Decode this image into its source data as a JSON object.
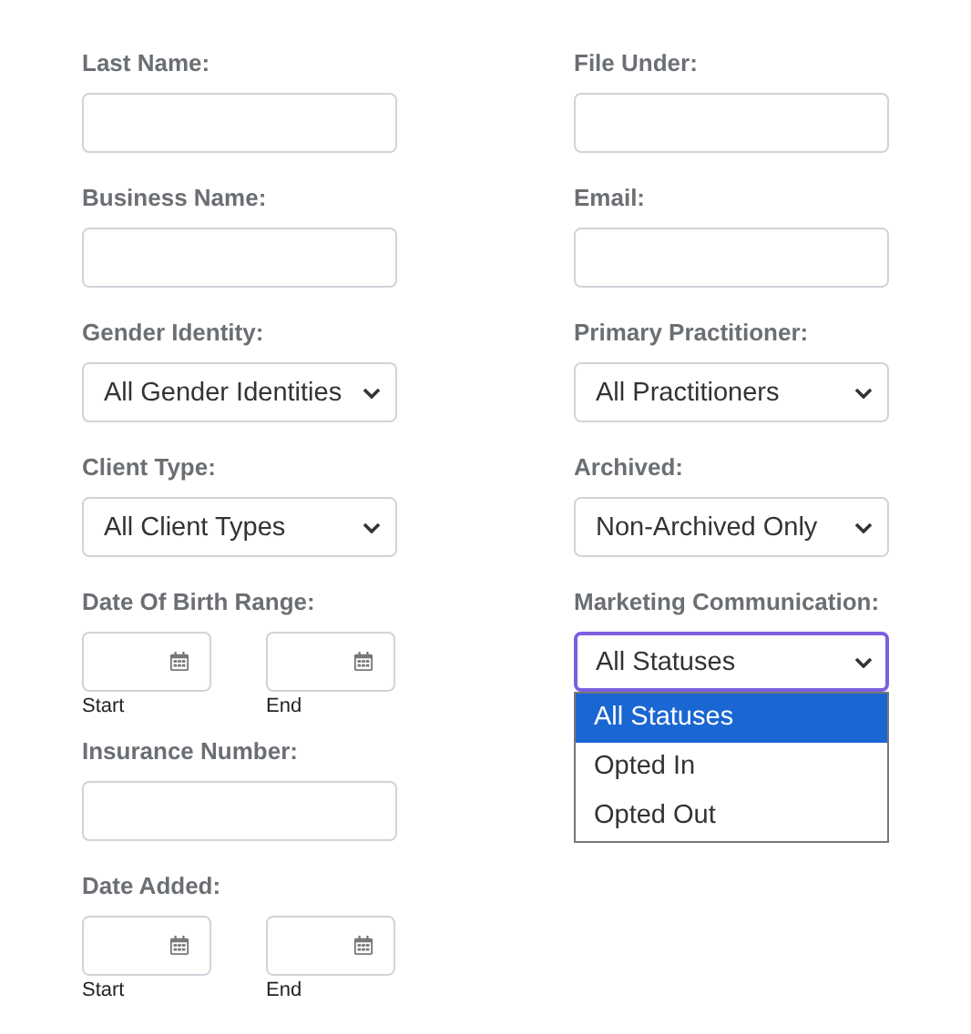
{
  "columns": [
    {
      "fields": [
        {
          "kind": "text",
          "label": "Last Name:"
        },
        {
          "kind": "text",
          "label": "Business Name:"
        },
        {
          "kind": "select",
          "label": "Gender Identity:",
          "value": "All Gender Identities",
          "focused": false,
          "open": false
        },
        {
          "kind": "select",
          "label": "Client Type:",
          "value": "All Client Types",
          "focused": false,
          "open": false
        },
        {
          "kind": "daterange",
          "label": "Date Of Birth Range:",
          "start_label": "Start",
          "end_label": "End"
        },
        {
          "kind": "text",
          "label": "Insurance Number:"
        },
        {
          "kind": "daterange",
          "label": "Date Added:",
          "start_label": "Start",
          "end_label": "End"
        }
      ]
    },
    {
      "fields": [
        {
          "kind": "text",
          "label": "File Under:"
        },
        {
          "kind": "text",
          "label": "Email:"
        },
        {
          "kind": "select",
          "label": "Primary Practitioner:",
          "value": "All Practitioners",
          "focused": false,
          "open": false
        },
        {
          "kind": "select",
          "label": "Archived:",
          "value": "Non-Archived Only",
          "focused": false,
          "open": false
        },
        {
          "kind": "select",
          "label": "Marketing Communication:",
          "value": "All Statuses",
          "focused": true,
          "open": true,
          "options": [
            {
              "label": "All Statuses",
              "selected": true
            },
            {
              "label": "Opted In",
              "selected": false
            },
            {
              "label": "Opted Out",
              "selected": false
            }
          ]
        }
      ]
    }
  ]
}
